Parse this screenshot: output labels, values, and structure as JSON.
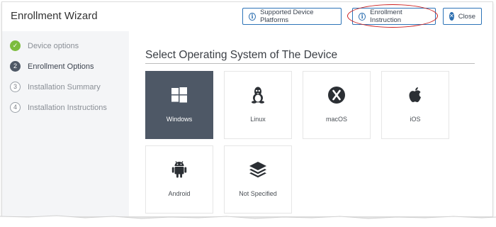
{
  "header": {
    "title": "Enrollment Wizard",
    "buttons": {
      "platforms": "Supported Device Platforms",
      "instruction": "Enrollment Instruction",
      "close": "Close"
    }
  },
  "sidebar": {
    "steps": [
      {
        "marker": "✓",
        "label": "Device options",
        "state": "done"
      },
      {
        "marker": "2",
        "label": "Enrollment Options",
        "state": "active"
      },
      {
        "marker": "3",
        "label": "Installation Summary",
        "state": "pending"
      },
      {
        "marker": "4",
        "label": "Installation Instructions",
        "state": "pending"
      }
    ]
  },
  "main": {
    "title": "Select Operating System of The Device",
    "tiles": [
      {
        "label": "Windows",
        "icon": "windows-icon",
        "selected": true
      },
      {
        "label": "Linux",
        "icon": "linux-icon",
        "selected": false
      },
      {
        "label": "macOS",
        "icon": "macos-icon",
        "selected": false
      },
      {
        "label": "iOS",
        "icon": "apple-icon",
        "selected": false
      },
      {
        "label": "Android",
        "icon": "android-icon",
        "selected": false
      },
      {
        "label": "Not Specified",
        "icon": "layers-icon",
        "selected": false
      }
    ]
  },
  "colors": {
    "accent": "#2d6fb0",
    "selected_tile": "#4e5866",
    "done_step": "#7cbc3e",
    "highlight": "#cc1f1f"
  }
}
